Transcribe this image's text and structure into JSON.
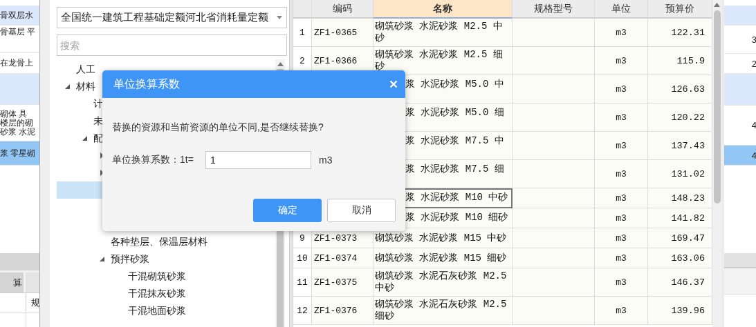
{
  "background_left": {
    "rows": [
      {
        "kind": "group",
        "selected": false,
        "lines": [
          "骨双层水"
        ]
      },
      {
        "kind": "item",
        "selected": false,
        "lines": [
          "骨基层 平"
        ]
      },
      {
        "kind": "item",
        "selected": false,
        "lines": [
          "在龙骨上"
        ]
      },
      {
        "kind": "group",
        "selected": false
      },
      {
        "kind": "item",
        "selected": false,
        "lines": [
          "砌体 具",
          "楼层的砌",
          "砂浆 水泥"
        ]
      },
      {
        "kind": "item",
        "selected": true,
        "lines": [
          "浆 零星砌"
        ]
      }
    ],
    "tabs": [
      {
        "label": "算",
        "selected": false
      }
    ],
    "column_header": "规"
  },
  "resource_panel": {
    "dropdown": {
      "value": "全国统一建筑工程基础定额河北省消耗量定额"
    },
    "search": {
      "placeholder": "搜索"
    },
    "tree": [
      {
        "label": "人工",
        "selected": false
      },
      {
        "label": "材料",
        "selected": false,
        "expanded": true,
        "children": [
          {
            "label": "计",
            "selected": false
          },
          {
            "label": "未",
            "selected": false
          },
          {
            "label": "配",
            "selected": false,
            "expanded": true,
            "children": [
              {
                "selected": false,
                "expanded": false
              },
              {
                "selected": false,
                "expanded": false
              },
              {
                "selected": true
              },
              {
                "kind": "covered"
              },
              {
                "kind": "covered"
              },
              {
                "label": "各种垫层、保温层材料",
                "selected": false
              },
              {
                "label": "预拌砂浆",
                "selected": false,
                "expanded": true,
                "children": [
                  {
                    "label": "干混砌筑砂浆",
                    "selected": false
                  },
                  {
                    "label": "干混抹灰砂浆",
                    "selected": false
                  },
                  {
                    "label": "干混地面砂浆",
                    "selected": false
                  }
                ]
              }
            ]
          }
        ]
      }
    ]
  },
  "table": {
    "columns": [
      {
        "label": "编码",
        "selected": false
      },
      {
        "label": "名称",
        "selected": true
      },
      {
        "label": "规格型号",
        "selected": false
      },
      {
        "label": "单位",
        "selected": false
      },
      {
        "label": "预算价",
        "selected": false
      }
    ],
    "rows": [
      {
        "kind": "full",
        "index": "1",
        "code": "ZF1-0365",
        "name": [
          "砌筑砂浆 水泥砂浆 M2.5 中",
          "砂"
        ],
        "unit": "m3",
        "price": "122.31",
        "focused": false
      },
      {
        "kind": "full",
        "index": "2",
        "code": "ZF1-0366",
        "name": [
          "砌筑砂浆 水泥砂浆 M2.5 细",
          "砂"
        ],
        "unit": "m3",
        "price": "115.9",
        "focused": false
      },
      {
        "kind": "covered-tall",
        "name": [
          "浆 水泥砂浆 M5.0 中"
        ],
        "unit": "m3",
        "price": "126.63",
        "focused": false
      },
      {
        "kind": "covered-tall",
        "name": [
          "浆 水泥砂浆 M5.0 细"
        ],
        "unit": "m3",
        "price": "120.22",
        "focused": false
      },
      {
        "kind": "covered-tall",
        "name": [
          "浆 水泥砂浆 M7.5 中"
        ],
        "unit": "m3",
        "price": "137.43",
        "focused": false
      },
      {
        "kind": "covered-tall",
        "name": [
          "浆 水泥砂浆 M7.5 细"
        ],
        "unit": "m3",
        "price": "131.02",
        "focused": false
      },
      {
        "kind": "covered",
        "name": [
          "浆 水泥砂浆 M10 中砂"
        ],
        "unit": "m3",
        "price": "148.23",
        "focused": true
      },
      {
        "kind": "covered",
        "name": [
          "浆 水泥砂浆 M10 细砂"
        ],
        "unit": "m3",
        "price": "141.82",
        "focused": false
      },
      {
        "kind": "full",
        "index": "9",
        "code": "ZF1-0373",
        "name": [
          "砌筑砂浆 水泥砂浆 M15 中砂"
        ],
        "unit": "m3",
        "price": "169.47",
        "focused": false
      },
      {
        "kind": "full",
        "index": "10",
        "code": "ZF1-0374",
        "name": [
          "砌筑砂浆 水泥砂浆 M15 细砂"
        ],
        "unit": "m3",
        "price": "163.06",
        "focused": false
      },
      {
        "kind": "full",
        "index": "11",
        "code": "ZF1-0375",
        "name": [
          "砌筑砂浆 水泥石灰砂浆 M2.5",
          "中砂"
        ],
        "unit": "m3",
        "price": "146.37",
        "focused": false
      },
      {
        "kind": "full",
        "index": "12",
        "code": "ZF1-0376",
        "name": [
          "砌筑砂浆 水泥石灰砂浆 M2.5",
          "细砂"
        ],
        "unit": "m3",
        "price": "139.96",
        "focused": false
      }
    ]
  },
  "background_right": {
    "rows": [
      {
        "kind": "group",
        "selected": false
      },
      {
        "kind": "item",
        "selected": false,
        "text": "3"
      },
      {
        "kind": "item",
        "selected": false,
        "text": "2"
      },
      {
        "kind": "group",
        "selected": false
      },
      {
        "kind": "item",
        "selected": false,
        "text": "4"
      },
      {
        "kind": "item",
        "selected": true,
        "text": "4"
      }
    ]
  },
  "dialog": {
    "title": "单位换算系数",
    "message": "替换的资源和当前资源的单位不同,是否继续替换?",
    "field_label": "单位换算系数：1t=",
    "field_value": "1",
    "unit": "m3",
    "buttons": [
      {
        "label": "确定",
        "kind": "primary"
      },
      {
        "label": "取消",
        "kind": "default"
      }
    ]
  }
}
